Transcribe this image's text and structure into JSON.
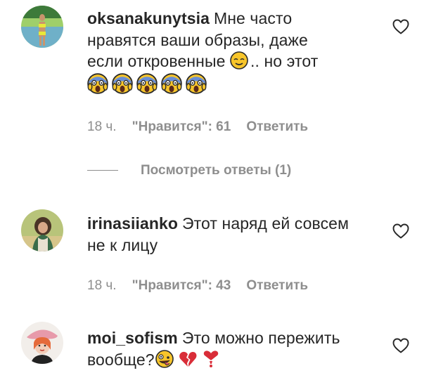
{
  "comments": [
    {
      "username": "oksanakunytsia",
      "line1": "Мне часто",
      "line2": "нравятся ваши образы, даже",
      "line3": "если откровенные",
      "line3_tail": ".. но этот",
      "time": "18 ч.",
      "likes": "\"Нравится\": 61",
      "reply": "Ответить",
      "view_replies": "Посмотреть ответы (1)"
    },
    {
      "username": "irinasiianko",
      "line1": "Этот наряд ей совсем",
      "line2": "не к лицу",
      "time": "18 ч.",
      "likes": "\"Нравится\": 43",
      "reply": "Ответить"
    },
    {
      "username": "moi_sofism",
      "line1": "Это можно пережить",
      "line2": "вообще?"
    }
  ],
  "icons": {
    "like": "heart-outline-icon",
    "emoji_relieved": "relieved-face-emoji",
    "emoji_scream": "screaming-face-emoji",
    "emoji_zany": "zany-face-emoji",
    "emoji_broken_heart": "broken-heart-emoji",
    "emoji_exclamation_heart": "heart-exclamation-emoji"
  },
  "colors": {
    "text": "#262626",
    "secondary": "#8e8e8e",
    "emoji_yellow": "#f7c52b",
    "emoji_red": "#d92d38"
  }
}
